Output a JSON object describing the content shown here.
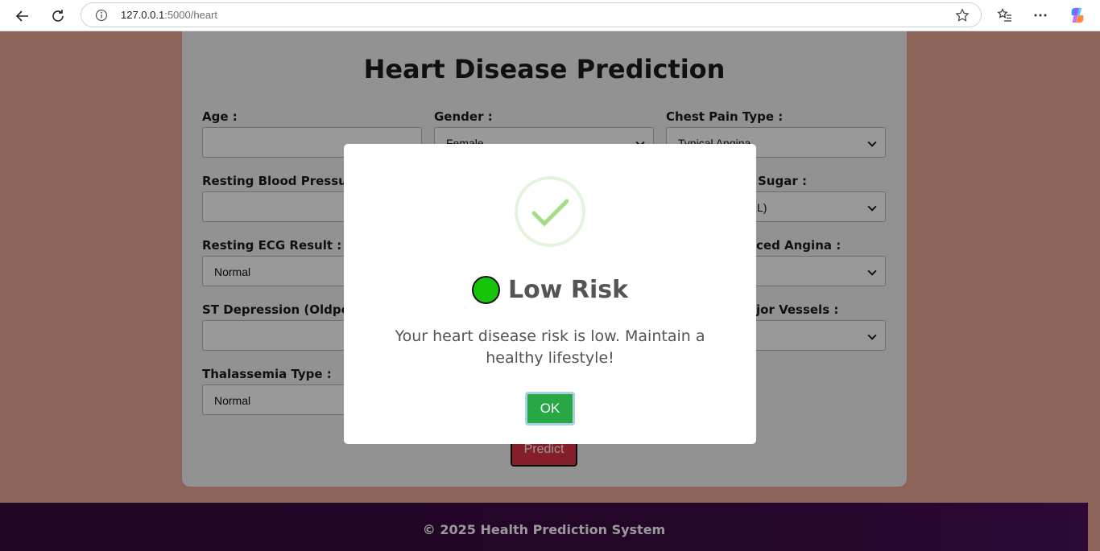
{
  "browser": {
    "url_host": "127.0.0.1",
    "url_path": ":5000/heart"
  },
  "form": {
    "title": "Heart Disease Prediction",
    "fields": [
      {
        "label": "Age :",
        "value": ""
      },
      {
        "label": "Gender :",
        "value": "Female"
      },
      {
        "label": "Chest Pain Type :",
        "value": "Typical Angina"
      },
      {
        "label": "Resting Blood Pressure",
        "value": ""
      },
      {
        "label": "Sugar :",
        "value": "L)"
      },
      {
        "label": "Resting ECG Result :",
        "value": "Normal"
      },
      {
        "label": "ced Angina :",
        "value": ""
      },
      {
        "label": "ST Depression (Oldpea",
        "value": ""
      },
      {
        "label": "jor Vessels :",
        "value": ""
      },
      {
        "label": "Thalassemia Type :",
        "value": "Normal"
      }
    ],
    "predict_label": "Predict"
  },
  "footer": {
    "text": "© 2025 Health Prediction System"
  },
  "modal": {
    "title": "Low Risk",
    "message": "Your heart disease risk is low. Maintain a healthy lifestyle!",
    "ok_label": "OK"
  },
  "colors": {
    "page_bg": "#e8a594",
    "predict_button": "#dc3545",
    "ok_button": "#28a745",
    "risk_indicator": "#17c40c",
    "footer_bg": "#3b0a44"
  }
}
